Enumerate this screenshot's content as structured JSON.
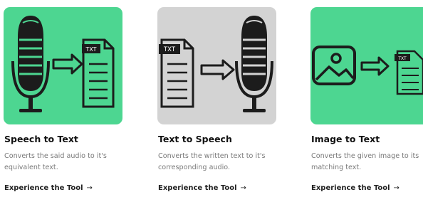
{
  "cards": [
    {
      "title": "Speech to Text",
      "description": "Converts the said audio to it's equivalent text.",
      "link_label": "Experience the Tool",
      "link_arrow": "→",
      "icons": [
        "microphone-icon",
        "arrow-right-icon",
        "txt-document-icon"
      ],
      "document_tag": "TXT",
      "background_color": "#4dd691"
    },
    {
      "title": "Text to Speech",
      "description": "Converts the written text to it's corresponding audio.",
      "link_label": "Experience the Tool",
      "link_arrow": "→",
      "icons": [
        "txt-document-icon",
        "arrow-right-icon",
        "microphone-icon"
      ],
      "document_tag": "TXT",
      "background_color": "#d3d3d3"
    },
    {
      "title": "Image to Text",
      "description": "Converts the given image to its matching text.",
      "link_label": "Experience the Tool",
      "link_arrow": "→",
      "icons": [
        "image-icon",
        "arrow-right-icon",
        "txt-document-icon"
      ],
      "document_tag": "TXT",
      "background_color": "#4dd691"
    }
  ]
}
